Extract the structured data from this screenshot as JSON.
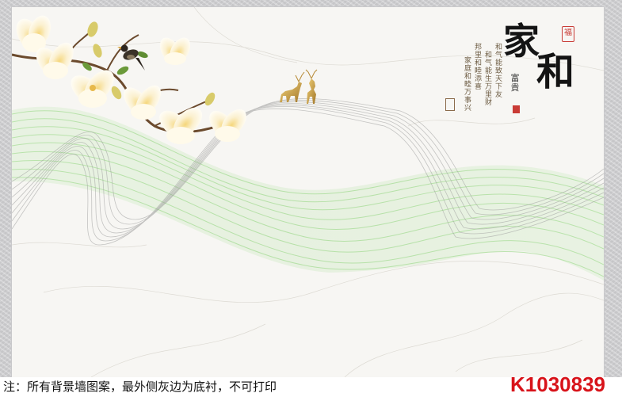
{
  "artwork": {
    "title": "家和",
    "seal_top": "福",
    "subtitle": "富貴",
    "couplets": [
      "和气能致天下友",
      "和气能生万里财",
      "邦里和睦添喜",
      "家庭和睦万事兴"
    ]
  },
  "footer": {
    "note": "注：所有背景墙图案，最外侧灰边为底衬，不可打印",
    "code": "K1030839"
  },
  "colors": {
    "background_border": "#d4d4d6",
    "marble": "#f7f6f3",
    "wave_green": "#8fd47a",
    "wave_grey": "#9a9a9a",
    "flower": "#f3e6b5",
    "code_red": "#d8131a",
    "seal_red": "#c93b35"
  }
}
